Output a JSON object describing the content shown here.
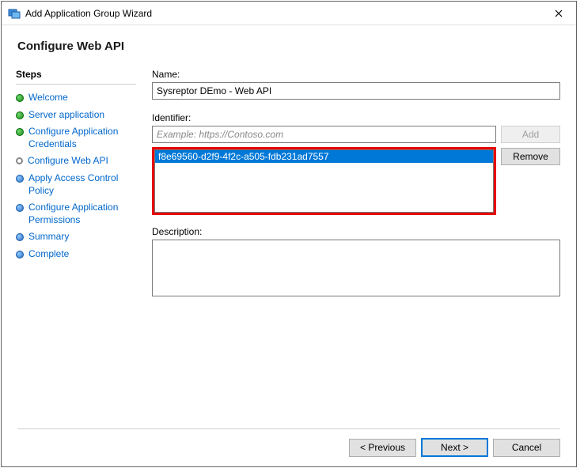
{
  "window": {
    "title": "Add Application Group Wizard"
  },
  "header": {
    "title": "Configure Web API"
  },
  "sidebar": {
    "heading": "Steps",
    "items": [
      {
        "label": "Welcome",
        "state": "done"
      },
      {
        "label": "Server application",
        "state": "done"
      },
      {
        "label": "Configure Application Credentials",
        "state": "done"
      },
      {
        "label": "Configure Web API",
        "state": "current"
      },
      {
        "label": "Apply Access Control Policy",
        "state": "future"
      },
      {
        "label": "Configure Application Permissions",
        "state": "future"
      },
      {
        "label": "Summary",
        "state": "future"
      },
      {
        "label": "Complete",
        "state": "future"
      }
    ]
  },
  "form": {
    "name_label": "Name:",
    "name_value": "Sysreptor DEmo - Web API",
    "identifier_label": "Identifier:",
    "identifier_placeholder": "Example: https://Contoso.com",
    "identifier_value": "",
    "add_button": "Add",
    "remove_button": "Remove",
    "identifier_list": [
      "f8e69560-d2f9-4f2c-a505-fdb231ad7557"
    ],
    "description_label": "Description:",
    "description_value": ""
  },
  "footer": {
    "previous": "< Previous",
    "next": "Next >",
    "cancel": "Cancel"
  }
}
